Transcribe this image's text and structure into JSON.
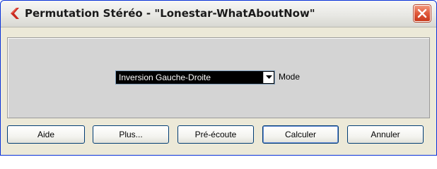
{
  "window": {
    "title": "Permutation Stéréo - \"Lonestar-WhatAboutNow\"",
    "icon": "cubase-back-arrow-icon",
    "close_icon": "close-icon",
    "accent_color": "#d9342b"
  },
  "main": {
    "mode_select": {
      "value": "Inversion Gauche-Droite",
      "arrow_icon": "chevron-down-icon"
    },
    "mode_label": "Mode"
  },
  "buttons": {
    "help": "Aide",
    "more": "Plus...",
    "preview": "Pré-écoute",
    "process": "Calculer",
    "cancel": "Annuler"
  }
}
